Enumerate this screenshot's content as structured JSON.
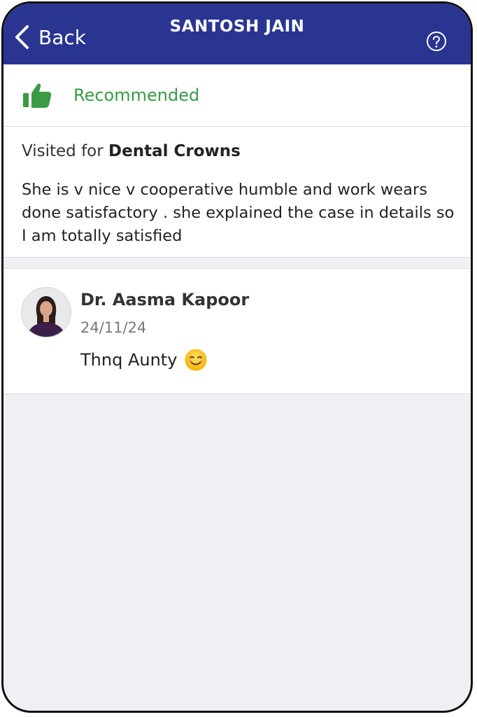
{
  "header": {
    "back_label": "Back",
    "title": "SANTOSH JAIN",
    "background": "#2a3592"
  },
  "recommendation": {
    "label": "Recommended",
    "color": "#3a9a46"
  },
  "review": {
    "visited_prefix": "Visited for ",
    "treatment": "Dental Crowns",
    "text": "She is v nice v cooperative humble and work wears done satisfactory . she explained the case in details so I am totally satisfied"
  },
  "reply": {
    "author": "Dr. Aasma Kapoor",
    "date": "24/11/24",
    "text": "Thnq Aunty",
    "emoji_icon": "smiling-face-emoji"
  }
}
